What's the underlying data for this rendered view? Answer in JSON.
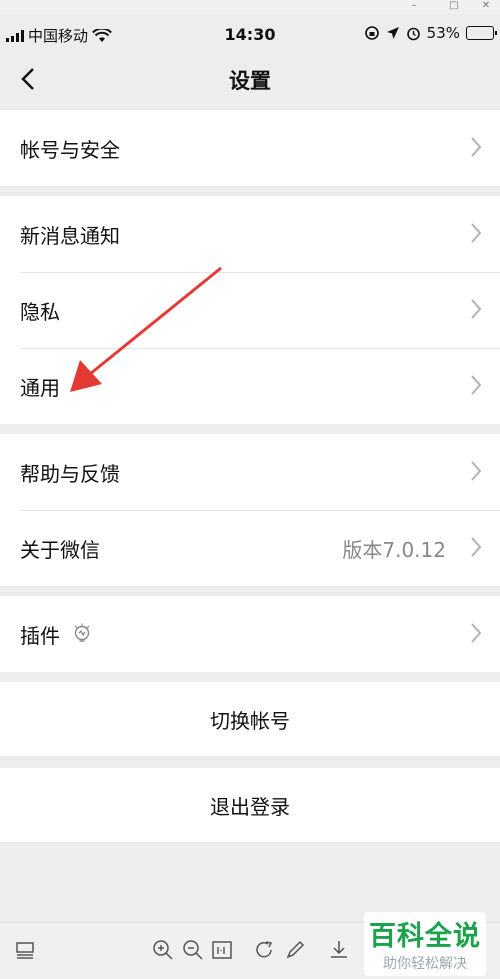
{
  "status_bar": {
    "carrier": "中国移动",
    "time": "14:30",
    "battery": "53%",
    "battery_level": 0.53
  },
  "nav": {
    "title": "设置"
  },
  "groups": [
    {
      "items": [
        {
          "label": "帐号与安全"
        }
      ]
    },
    {
      "items": [
        {
          "label": "新消息通知"
        },
        {
          "label": "隐私"
        },
        {
          "label": "通用"
        }
      ]
    },
    {
      "items": [
        {
          "label": "帮助与反馈"
        },
        {
          "label": "关于微信",
          "value": "版本7.0.12"
        }
      ]
    },
    {
      "items": [
        {
          "label": "插件"
        }
      ]
    }
  ],
  "actions": {
    "switch_account": "切换帐号",
    "logout": "退出登录"
  },
  "colors": {
    "accent": "#1aa34a",
    "arrow": "#e53935",
    "battery": "#2bb52b"
  },
  "watermark": {
    "big": "百科全说",
    "small": "助你轻松解决"
  }
}
